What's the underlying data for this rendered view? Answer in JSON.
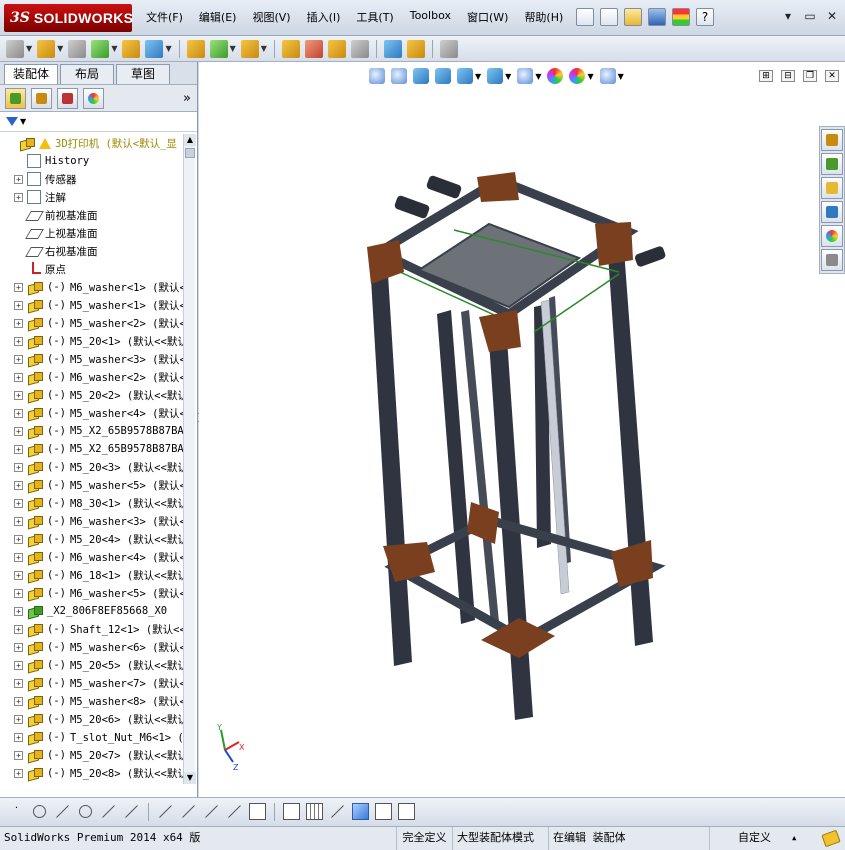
{
  "app": {
    "brand_ds": "3S",
    "brand_name": "SOLIDWORKS",
    "menu": [
      "文件(F)",
      "编辑(E)",
      "视图(V)",
      "插入(I)",
      "工具(T)",
      "Toolbox",
      "窗口(W)",
      "帮助(H)"
    ],
    "help_icon": "?",
    "window_controls": [
      "▾",
      "▭",
      "✕"
    ]
  },
  "left_panel": {
    "tabs": [
      "装配体",
      "布局",
      "草图"
    ],
    "active_tab": "装配体",
    "expand_glyph": "»",
    "tree": [
      {
        "kind": "assembly",
        "prefix": "",
        "label": "3D打印机  (默认<默认_显"
      },
      {
        "kind": "history",
        "prefix": "",
        "label": "History"
      },
      {
        "kind": "sensor",
        "prefix": "",
        "label": "传感器"
      },
      {
        "kind": "annotation",
        "prefix": "",
        "label": "注解"
      },
      {
        "kind": "plane",
        "prefix": "",
        "label": "前视基准面"
      },
      {
        "kind": "plane",
        "prefix": "",
        "label": "上视基准面"
      },
      {
        "kind": "plane",
        "prefix": "",
        "label": "右视基准面"
      },
      {
        "kind": "origin",
        "prefix": "",
        "label": "原点"
      },
      {
        "kind": "part",
        "prefix": "(-)",
        "label": "M6_washer<1> (默认<"
      },
      {
        "kind": "part",
        "prefix": "(-)",
        "label": "M5_washer<1> (默认<"
      },
      {
        "kind": "part",
        "prefix": "(-)",
        "label": "M5_washer<2> (默认<"
      },
      {
        "kind": "part",
        "prefix": "(-)",
        "label": "M5_20<1> (默认<<默认"
      },
      {
        "kind": "part",
        "prefix": "(-)",
        "label": "M5_washer<3> (默认<"
      },
      {
        "kind": "part",
        "prefix": "(-)",
        "label": "M6_washer<2> (默认<"
      },
      {
        "kind": "part",
        "prefix": "(-)",
        "label": "M5_20<2> (默认<<默认"
      },
      {
        "kind": "part",
        "prefix": "(-)",
        "label": "M5_washer<4> (默认<"
      },
      {
        "kind": "part",
        "prefix": "(-)",
        "label": "M5_X2_65B9578B87BA5"
      },
      {
        "kind": "part",
        "prefix": "(-)",
        "label": "M5_X2_65B9578B87BA5"
      },
      {
        "kind": "part",
        "prefix": "(-)",
        "label": "M5_20<3> (默认<<默认"
      },
      {
        "kind": "part",
        "prefix": "(-)",
        "label": "M5_washer<5> (默认<"
      },
      {
        "kind": "part",
        "prefix": "(-)",
        "label": "M8_30<1> (默认<<默认"
      },
      {
        "kind": "part",
        "prefix": "(-)",
        "label": "M6_washer<3> (默认<"
      },
      {
        "kind": "part",
        "prefix": "(-)",
        "label": "M5_20<4> (默认<<默认"
      },
      {
        "kind": "part",
        "prefix": "(-)",
        "label": "M6_washer<4> (默认<"
      },
      {
        "kind": "part",
        "prefix": "(-)",
        "label": "M6_18<1> (默认<<默认"
      },
      {
        "kind": "part",
        "prefix": "(-)",
        "label": "M6_washer<5> (默认<"
      },
      {
        "kind": "part-green",
        "prefix": "",
        "label": "_X2_806F8EF85668_X0"
      },
      {
        "kind": "part",
        "prefix": "(-)",
        "label": "Shaft_12<1> (默认<<"
      },
      {
        "kind": "part",
        "prefix": "(-)",
        "label": "M5_washer<6> (默认<"
      },
      {
        "kind": "part",
        "prefix": "(-)",
        "label": "M5_20<5> (默认<<默认"
      },
      {
        "kind": "part",
        "prefix": "(-)",
        "label": "M5_washer<7> (默认<"
      },
      {
        "kind": "part",
        "prefix": "(-)",
        "label": "M5_washer<8> (默认<"
      },
      {
        "kind": "part",
        "prefix": "(-)",
        "label": "M5_20<6> (默认<<默认"
      },
      {
        "kind": "part",
        "prefix": "(-)",
        "label": "T_slot_Nut_M6<1> (默"
      },
      {
        "kind": "part",
        "prefix": "(-)",
        "label": "M5_20<7> (默认<<默认"
      },
      {
        "kind": "part",
        "prefix": "(-)",
        "label": "M5_20<8> (默认<<默认"
      }
    ]
  },
  "viewport": {
    "triad_axes": [
      "Y",
      "X",
      "Z"
    ],
    "controls": [
      "⊞",
      "⊟",
      "❐",
      "✕"
    ]
  },
  "status": {
    "product": "SolidWorks Premium 2014 x64 版",
    "definition": "完全定义",
    "mode": "大型装配体模式",
    "editing": "在编辑 装配体",
    "custom": "自定义",
    "custom_arrow": "▴"
  },
  "colors": {
    "frame_dark": "#2f3440",
    "bracket_rust": "#7a3f1e",
    "bed_gray": "#6d7178",
    "rail_green": "#2a8a2a"
  }
}
